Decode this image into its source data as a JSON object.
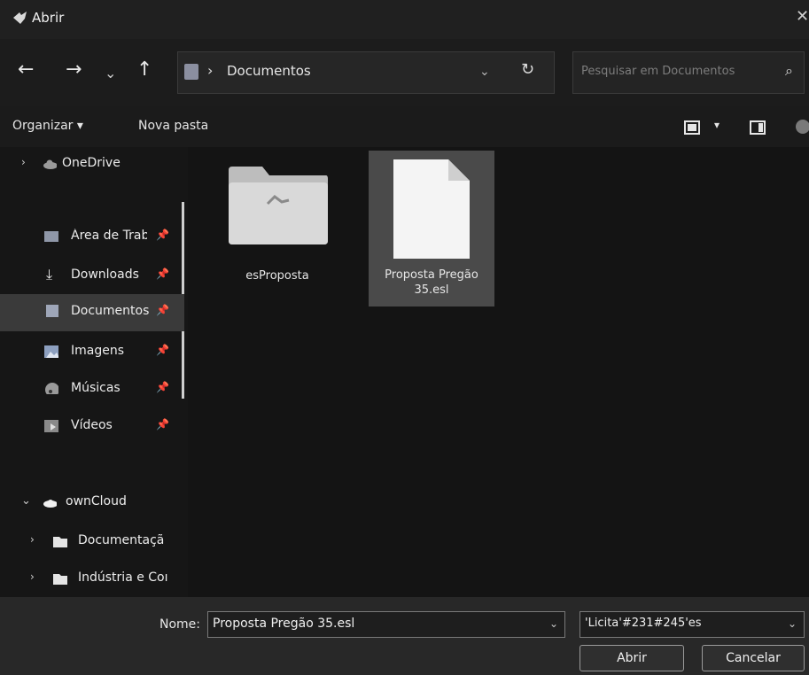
{
  "window": {
    "title": "Abrir",
    "close_glyph": "✕"
  },
  "nav": {
    "back": "←",
    "forward": "→",
    "recent": "⌄",
    "up": "↑",
    "address_separator": "›",
    "address_path": "Documentos",
    "address_dropdown": "⌄",
    "refresh": "↻",
    "search_placeholder": "Pesquisar em Documentos",
    "search_icon": "⌕"
  },
  "toolbar": {
    "organize": "Organizar ▾",
    "new_folder": "Nova pasta",
    "view_menu": "▾"
  },
  "sidebar": {
    "items": [
      {
        "label": "OneDrive",
        "icon": "cloud-icon"
      },
      {
        "label": "Área de Traba",
        "icon": "desktop-icon",
        "pinned": true
      },
      {
        "label": "Downloads",
        "icon": "download-icon",
        "pinned": true
      },
      {
        "label": "Documentos",
        "icon": "document-icon",
        "pinned": true,
        "selected": true
      },
      {
        "label": "Imagens",
        "icon": "image-icon",
        "pinned": true
      },
      {
        "label": "Músicas",
        "icon": "music-icon",
        "pinned": true
      },
      {
        "label": "Vídeos",
        "icon": "video-icon",
        "pinned": true
      },
      {
        "label": "ownCloud",
        "icon": "owncloud-icon"
      },
      {
        "label": "Documentaçã",
        "icon": "folder-icon"
      },
      {
        "label": "Indústria e Coı",
        "icon": "folder-icon"
      }
    ],
    "pin_glyph": "📌",
    "expand_glyph": "›",
    "expanded_glyph": "⌄",
    "download_glyph": "⤓"
  },
  "files": [
    {
      "name": "esProposta",
      "type": "folder"
    },
    {
      "name": "Proposta Pregão 35.esl",
      "type": "file",
      "selected": true
    }
  ],
  "footer": {
    "name_label": "Nome:",
    "name_value": "Proposta Pregão 35.esl",
    "type_value": "'Licita'#231#245'es",
    "dropdown_glyph": "⌄",
    "open_button": "Abrir",
    "cancel_button": "Cancelar"
  },
  "colors": {
    "background": "#191919",
    "selected": "#3a3a3a",
    "folder": "#d8d8d8"
  }
}
